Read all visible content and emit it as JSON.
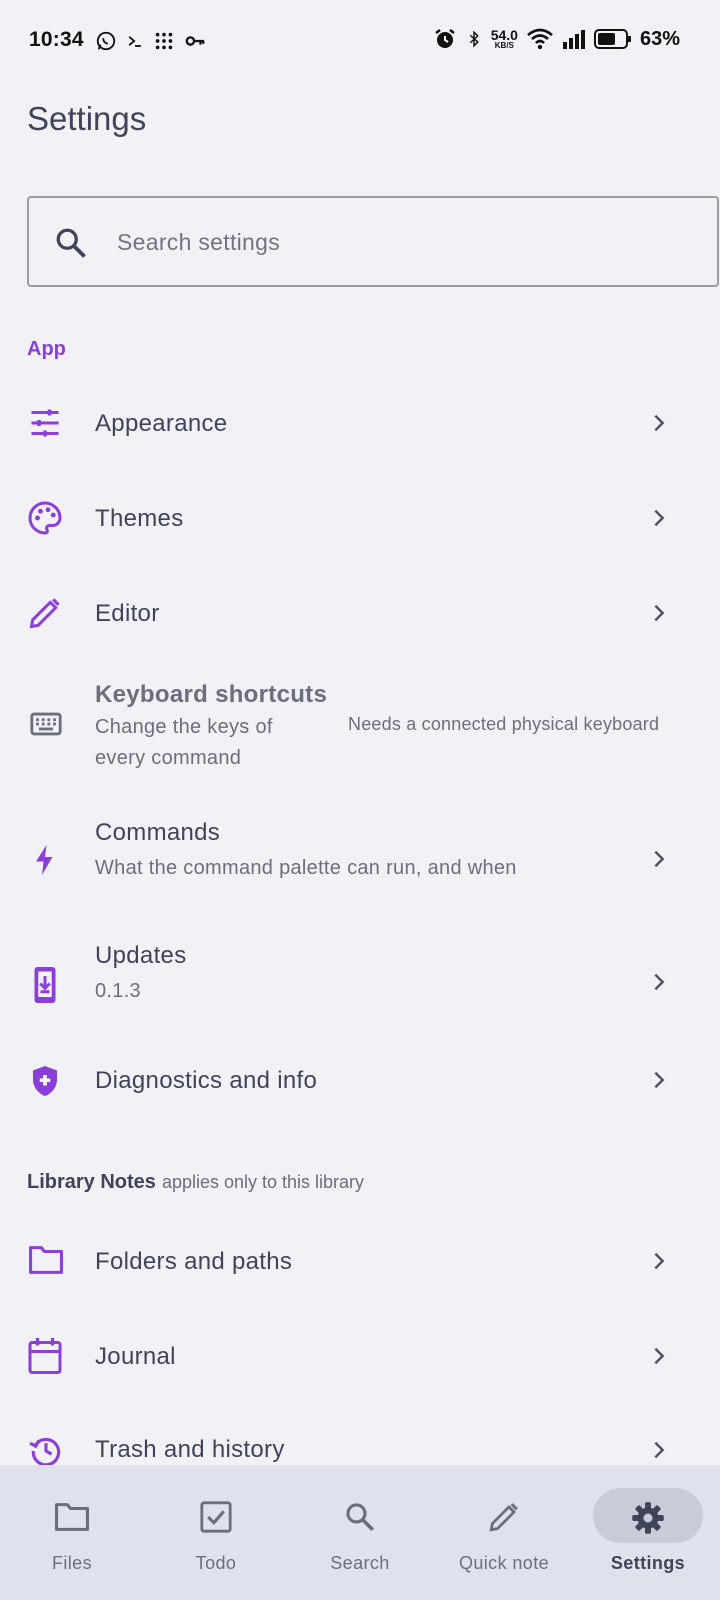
{
  "status_bar": {
    "time": "10:34",
    "net_speed_value": "54.0",
    "net_speed_unit": "KB/S",
    "battery_percent": "63%"
  },
  "page": {
    "title": "Settings"
  },
  "search": {
    "placeholder": "Search settings"
  },
  "sections": {
    "app": {
      "label": "App"
    },
    "library": {
      "label": "Library Notes",
      "sublabel": "applies only to this library"
    }
  },
  "items": {
    "appearance": {
      "title": "Appearance"
    },
    "themes": {
      "title": "Themes"
    },
    "editor": {
      "title": "Editor"
    },
    "keyboard_shortcuts": {
      "title": "Keyboard shortcuts",
      "subtitle_line1": "Change the keys of",
      "subtitle_line2": "every command",
      "side_note": "Needs a connected physical keyboard"
    },
    "commands": {
      "title": "Commands",
      "subtitle": "What the command palette can run, and when"
    },
    "updates": {
      "title": "Updates",
      "subtitle": "0.1.3"
    },
    "diagnostics": {
      "title": "Diagnostics and info"
    },
    "folders": {
      "title": "Folders and paths"
    },
    "journal": {
      "title": "Journal"
    },
    "trash": {
      "title": "Trash and history"
    }
  },
  "nav": {
    "files": "Files",
    "todo": "Todo",
    "search": "Search",
    "quick_note": "Quick note",
    "settings": "Settings",
    "active": "settings"
  },
  "colors": {
    "accent": "#8b3fd9",
    "text": "#3f4458",
    "muted": "#6b6f7d",
    "background": "#f1f1f6",
    "nav_background": "#dfe1ec"
  }
}
